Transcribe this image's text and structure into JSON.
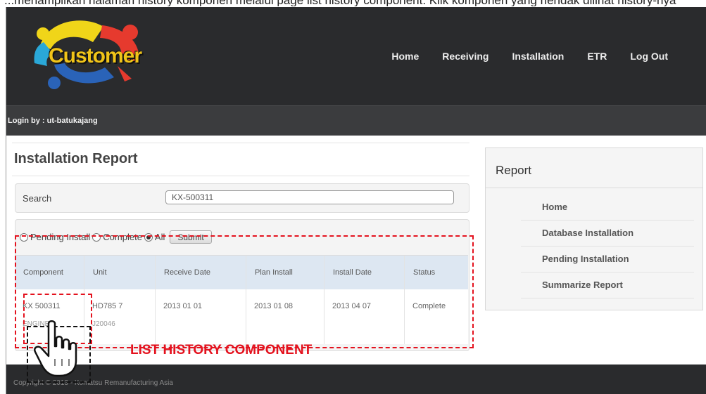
{
  "caption": "...menampilkan halaman history  komponen melalui page list history component. Klik komponen yang hendak dilihat history-nya",
  "header": {
    "logo_text": "Customer",
    "nav": [
      "Home",
      "Receiving",
      "Installation",
      "ETR",
      "Log Out"
    ]
  },
  "login_bar": {
    "text": "Login by : ut-batukajang"
  },
  "main": {
    "title": "Installation Report",
    "search": {
      "label": "Search",
      "value": "KX-500311"
    },
    "filter": {
      "options": [
        {
          "label": "Pending Install",
          "checked": false
        },
        {
          "label": "Complete",
          "checked": false
        },
        {
          "label": "All",
          "checked": true
        }
      ],
      "submit_label": "Submit"
    },
    "table": {
      "headers": [
        "Component",
        "Unit",
        "Receive Date",
        "Plan Install",
        "Install Date",
        "Status"
      ],
      "rows": [
        {
          "component": "KX 500311",
          "component_sub": "ENGINE",
          "unit": "HD785 7",
          "unit_sub": "J20046",
          "receive_date": "2013 01 01",
          "plan_install": "2013 01 08",
          "install_date": "2013 04 07",
          "status": "Complete"
        }
      ]
    }
  },
  "sidebar": {
    "title": "Report",
    "items": [
      "Home",
      "Database Installation",
      "Pending Installation",
      "Summarize Report"
    ]
  },
  "footer": {
    "text": "Copyright © 2013 - Komatsu Remanufacturing Asia"
  },
  "annotation": {
    "label": "LIST HISTORY COMPONENT",
    "color": "#e4121e"
  },
  "colors": {
    "header_bg": "#2a2b2d",
    "table_header_bg": "#dde7f2",
    "accent_red": "#e4121e"
  },
  "icons": {
    "cursor": "hand-pointer-icon",
    "logo": "customer-logo-icon"
  }
}
